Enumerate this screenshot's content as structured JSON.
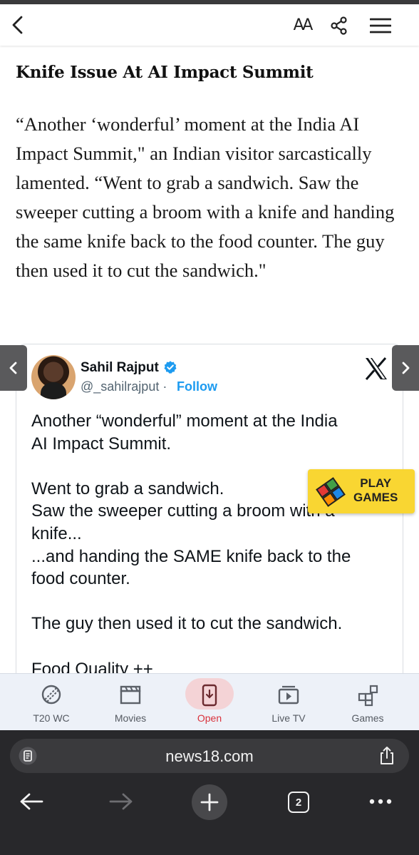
{
  "header": {
    "back_icon": "chevron-left-icon",
    "text_size_label": "AA",
    "share_icon": "share-icon",
    "menu_icon": "hamburger-menu-icon"
  },
  "article": {
    "title": "Knife Issue At AI Impact Summit",
    "body": "“Another ‘wonderful’ moment at the India AI Impact Summit,\" an Indian visitor sarcastically lamented. “Went to grab a sandwich. Saw the sweeper cutting a broom with a knife and handing the same knife back to the food counter. The guy then used it to cut the sandwich.\""
  },
  "tweet": {
    "author": "Sahil Rajput",
    "handle": "@_sahilrajput",
    "separator": "·",
    "follow_label": "Follow",
    "text": "Another “wonderful” moment at the India\nAI Impact Summit.\n\nWent to grab a sandwich.\nSaw the sweeper cutting a broom with a\nknife...\n...and handing the SAME knife back to the\nfood counter.\n\nThe guy then used it to cut the sandwich.\n\nFood Quality ++"
  },
  "promo": {
    "line1": "PLAY",
    "line2": "GAMES"
  },
  "bottom_nav": {
    "items": [
      {
        "label": "T20 WC",
        "icon": "cricket-ball-icon"
      },
      {
        "label": "Movies",
        "icon": "clapperboard-icon"
      },
      {
        "label": "Open",
        "icon": "download-phone-icon"
      },
      {
        "label": "Live TV",
        "icon": "tv-play-icon"
      },
      {
        "label": "Games",
        "icon": "puzzle-blocks-icon"
      }
    ]
  },
  "browser": {
    "url": "news18.com",
    "tab_count": "2"
  },
  "colors": {
    "accent_blue": "#1d9bf0",
    "open_red": "#d9323c",
    "promo_yellow": "#f9d632"
  }
}
